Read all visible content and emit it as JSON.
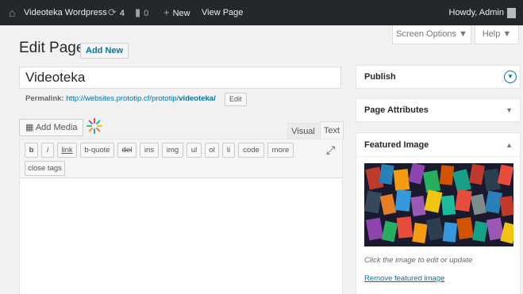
{
  "adminbar": {
    "site_name": "Videoteka Wordpress",
    "updates_count": "4",
    "comments_count": "0",
    "new_label": "New",
    "view_page_label": "View Page",
    "howdy": "Howdy, Admin"
  },
  "screen_options": {
    "label": "Screen Options ▼"
  },
  "help": {
    "label": "Help ▼"
  },
  "header": {
    "title": "Edit Page",
    "add_new": "Add New"
  },
  "post": {
    "title_value": "Videoteka",
    "permalink_label": "Permalink:",
    "permalink_base": "http://websites.prototip.cf/prototip/",
    "permalink_slug": "videoteka/",
    "edit_label": "Edit"
  },
  "editor": {
    "add_media": "Add Media",
    "tab_visual": "Visual",
    "tab_text": "Text",
    "quicktags": [
      "b",
      "i",
      "link",
      "b-quote",
      "del",
      "ins",
      "img",
      "ul",
      "ol",
      "li",
      "code",
      "more"
    ],
    "close_tags": "close tags"
  },
  "sidebar": {
    "publish": "Publish",
    "page_attributes": "Page Attributes",
    "featured_image": "Featured Image",
    "featured_caption": "Click the image to edit or update",
    "remove_featured": "Remove featured image"
  },
  "colors": {
    "adminbar": "#23282d",
    "link": "#0073aa",
    "background": "#f1f1f1"
  },
  "icons": [
    "home-icon",
    "updates-icon",
    "comment-icon",
    "plus-icon",
    "media-icon",
    "fullscreen-icon",
    "toggle-arrow-icon"
  ]
}
